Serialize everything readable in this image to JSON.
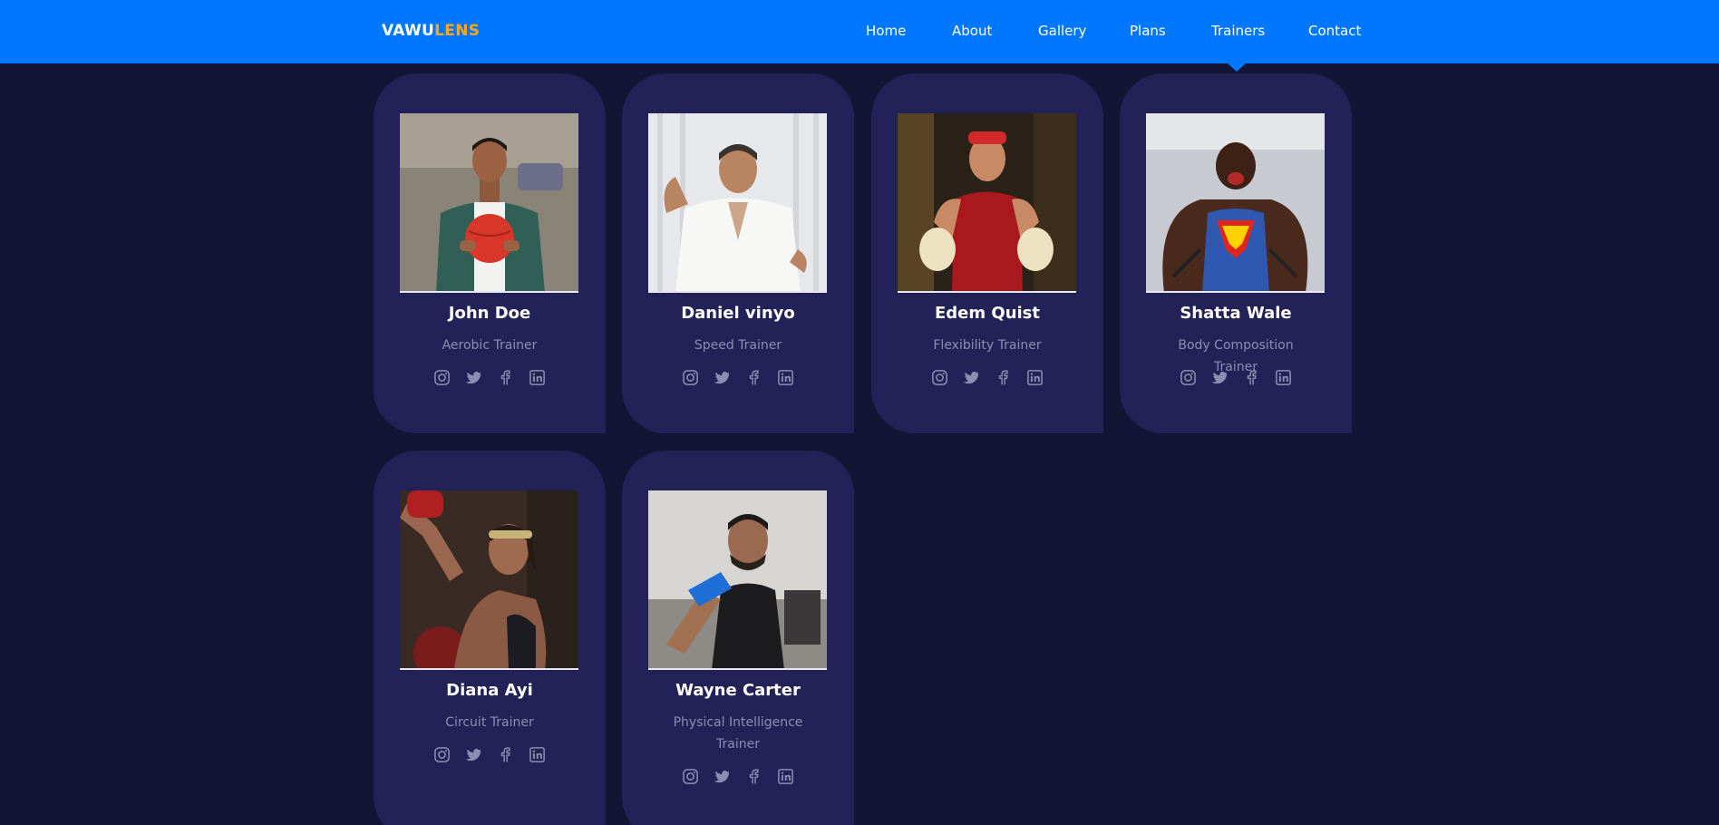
{
  "brand": {
    "part1": "VAWU",
    "part2": "LENS"
  },
  "nav": {
    "items": [
      {
        "label": "Home"
      },
      {
        "label": "About"
      },
      {
        "label": "Gallery"
      },
      {
        "label": "Plans"
      },
      {
        "label": "Trainers",
        "active": true
      },
      {
        "label": "Contact"
      }
    ]
  },
  "colors": {
    "header": "#0077ff",
    "background": "#141435",
    "card": "#222258",
    "brand_accent": "#f9a825",
    "muted_text": "#8d8db3"
  },
  "trainers": [
    {
      "name": "John Doe",
      "role": "Aerobic Trainer",
      "photo": "man-holding-red-medicine-ball"
    },
    {
      "name": "Daniel vinyo",
      "role": "Speed Trainer",
      "photo": "man-in-white-martial-arts-gi"
    },
    {
      "name": "Edem Quist",
      "role": "Flexibility Trainer",
      "photo": "boxer-in-red-tank-with-gloves"
    },
    {
      "name": "Shatta Wale",
      "role": "Body Composition Trainer",
      "photo": "muscular-man-superman-tank"
    },
    {
      "name": "Diana Ayi",
      "role": "Circuit Trainer",
      "photo": "woman-boxer-with-headband"
    },
    {
      "name": "Wayne Carter",
      "role": "Physical Intelligence Trainer",
      "photo": "man-with-blue-hand-wrap-pointing"
    }
  ],
  "social_icons": [
    "instagram-icon",
    "twitter-icon",
    "facebook-icon",
    "linkedin-icon"
  ]
}
